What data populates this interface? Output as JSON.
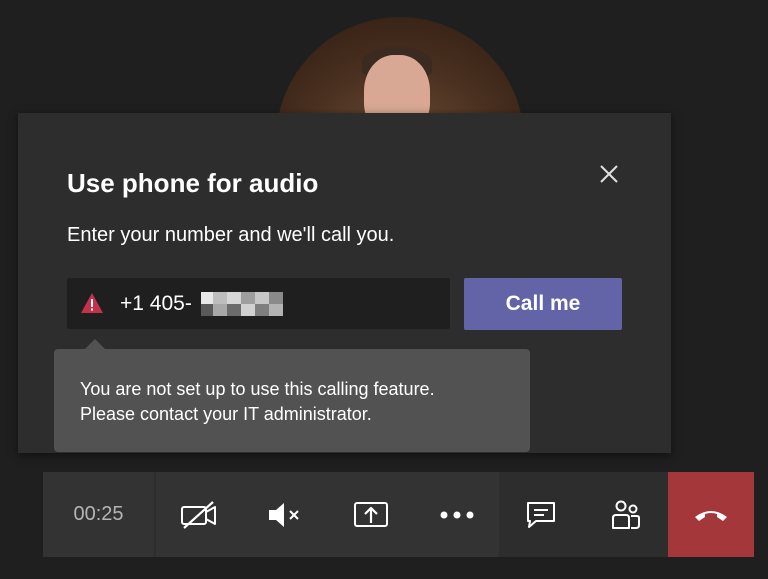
{
  "dialog": {
    "title": "Use phone for audio",
    "subtitle": "Enter your number and we'll call you.",
    "phone_value": "+1 405-",
    "call_button": "Call me",
    "error_line1": "You are not set up to use this calling feature.",
    "error_line2": "Please contact your IT administrator."
  },
  "controls": {
    "timer": "00:25"
  },
  "colors": {
    "accent": "#6264a7",
    "hangup": "#a4373a",
    "warning": "#c4314b"
  },
  "icons": [
    "close-icon",
    "warning-icon",
    "camera-off-icon",
    "speaker-muted-icon",
    "share-screen-icon",
    "more-icon",
    "chat-icon",
    "participants-icon",
    "hang-up-icon"
  ]
}
